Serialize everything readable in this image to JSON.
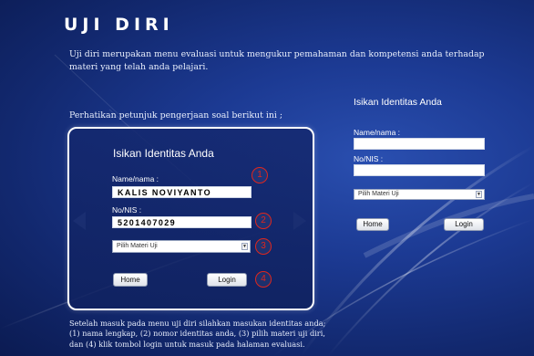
{
  "page": {
    "title": "UJI DIRI",
    "intro": "Uji diri merupakan menu evaluasi untuk mengukur pemahaman dan kompetensi anda terhadap materi yang telah anda pelajari.",
    "instruction": "Perhatikan petunjuk pengerjaan soal berikut ini ;",
    "outro_line1": "Setelah masuk pada menu uji diri silahkan masukan identitas anda;",
    "outro_line2": "(1) nama lengkap, (2) nomor identitas anda, (3) pilih materi uji diri,",
    "outro_line3": "dan (4) klik tombol login untuk masuk pada halaman evaluasi."
  },
  "example_form": {
    "title": "Isikan Identitas Anda",
    "name_label": "Name/nama  :",
    "name_value": "KALIS NOVIYANTO",
    "nis_label": "No/NIS  :",
    "nis_value": "5201407029",
    "select_value": "Pilih Materi Uji",
    "home_label": "Home",
    "login_label": "Login",
    "step_numbers": [
      "1",
      "2",
      "3",
      "4"
    ],
    "prev_icon": "triangle-left-icon",
    "next_icon": "triangle-right-icon",
    "step_color": "#e0261c"
  },
  "login_form": {
    "title": "Isikan Identitas Anda",
    "name_label": "Name/nama  :",
    "name_value": "",
    "nis_label": "No/NIS  :",
    "nis_value": "",
    "select_value": "Pilih Materi Uji",
    "home_label": "Home",
    "login_label": "Login"
  }
}
